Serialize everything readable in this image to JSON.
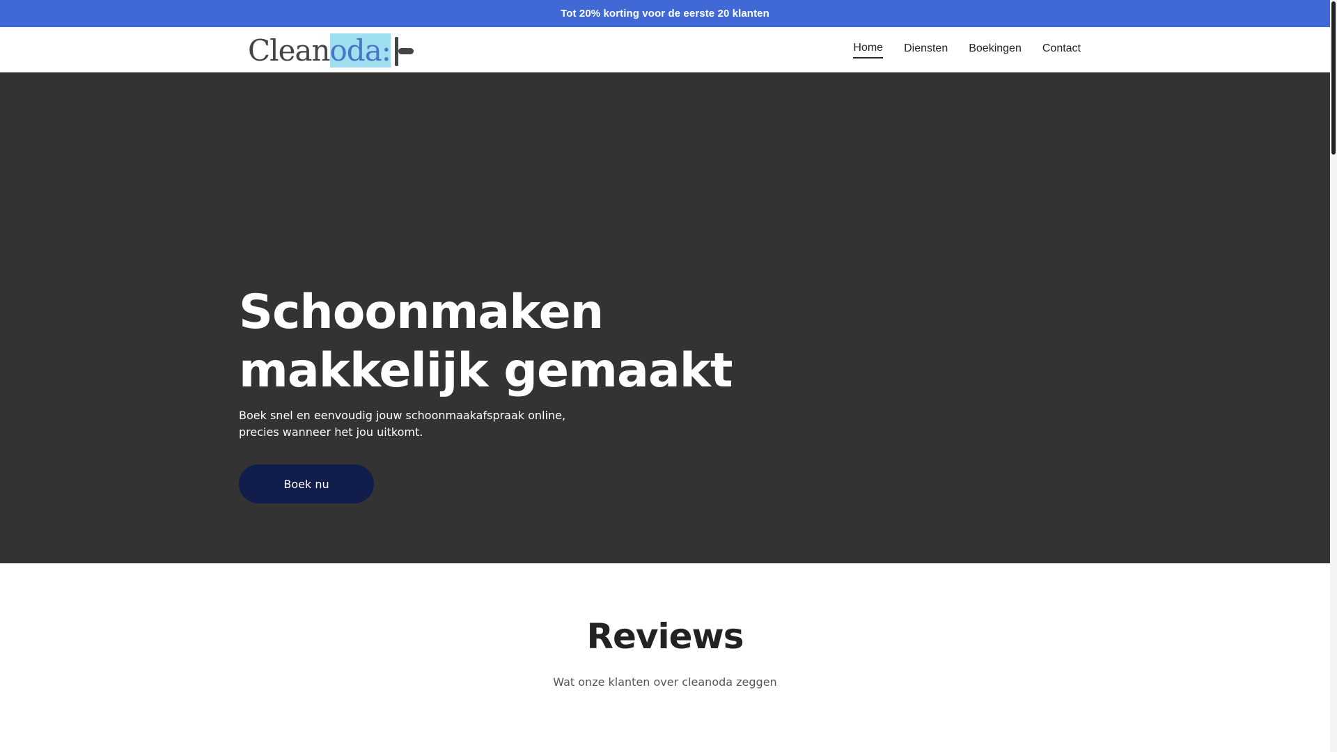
{
  "announcement": {
    "text": "Tot 20% korting voor de eerste 20 klanten"
  },
  "header": {
    "logo": {
      "prefix": "Clean",
      "highlight": "oda:",
      "alt": "Cleanoda"
    },
    "nav": [
      {
        "label": "Home",
        "active": true
      },
      {
        "label": "Diensten",
        "active": false
      },
      {
        "label": "Boekingen",
        "active": false
      },
      {
        "label": "Contact",
        "active": false
      }
    ]
  },
  "hero": {
    "title": "Schoonmaken makkelijk gemaakt",
    "subtitle": "Boek snel en eenvoudig jouw schoonmaakafspraak online, precies wanneer het jou uitkomt.",
    "cta_label": "Boek nu"
  },
  "reviews": {
    "title": "Reviews",
    "subtitle": "Wat onze klanten over cleanoda zeggen"
  },
  "colors": {
    "announcement_bg": "#4169d6",
    "hero_bg": "#333333",
    "button_bg": "#111d4a",
    "logo_highlight": "#9fdff0"
  }
}
